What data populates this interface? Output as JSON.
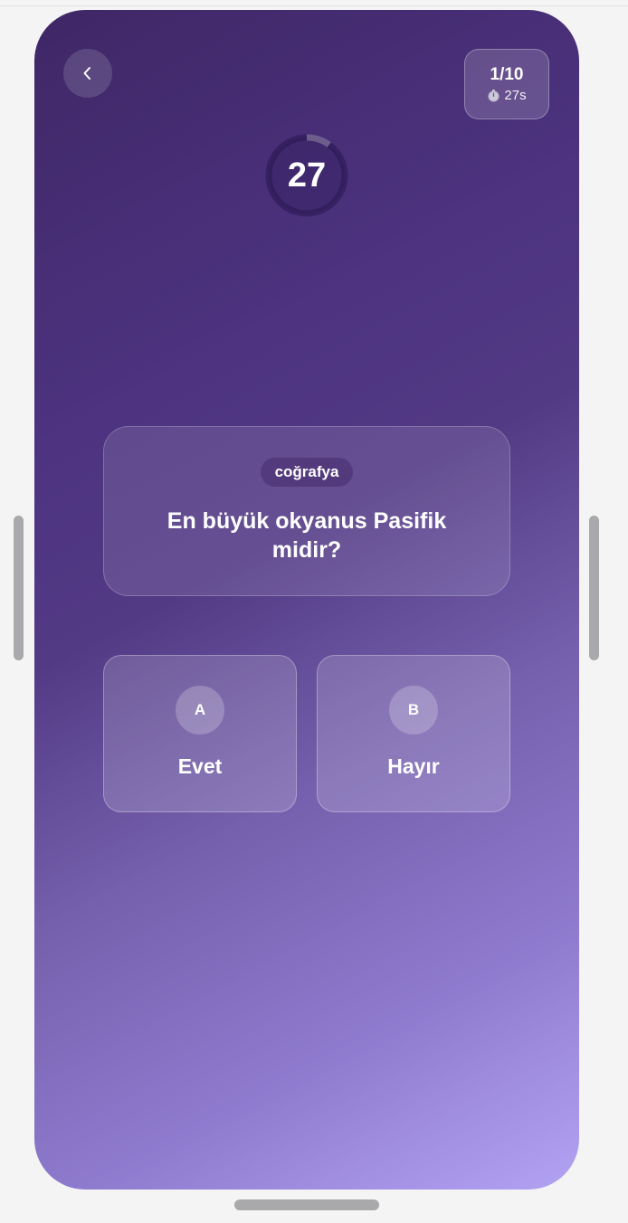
{
  "header": {
    "progress": "1/10",
    "time_left": "27s",
    "timer_icon": "stopwatch-icon",
    "back_icon": "chevron-left-icon"
  },
  "timer": {
    "value": "27",
    "remaining_fraction": 0.9
  },
  "question": {
    "category": "coğrafya",
    "text": "En büyük okyanus Pasifik midir?"
  },
  "answers": [
    {
      "letter": "A",
      "label": "Evet"
    },
    {
      "letter": "B",
      "label": "Hayır"
    }
  ]
}
